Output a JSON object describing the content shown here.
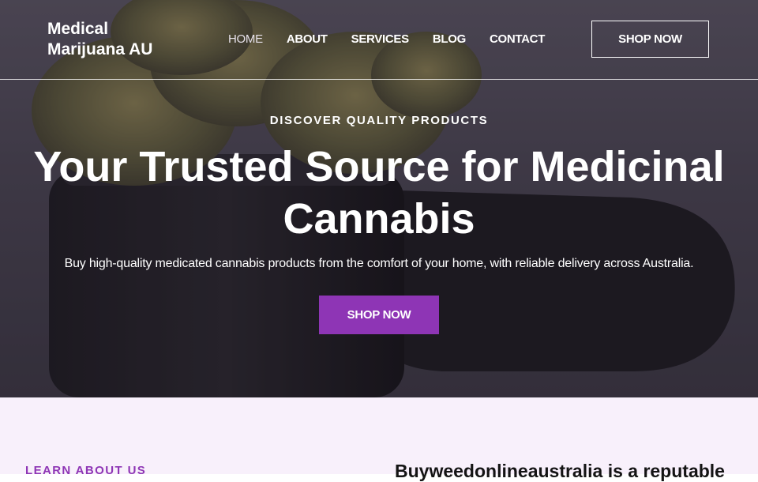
{
  "header": {
    "logo": "Medical Marijuana AU",
    "nav": [
      {
        "label": "HOME",
        "active": true
      },
      {
        "label": "ABOUT",
        "active": false
      },
      {
        "label": "SERVICES",
        "active": false
      },
      {
        "label": "BLOG",
        "active": false
      },
      {
        "label": "CONTACT",
        "active": false
      }
    ],
    "cta_label": "SHOP NOW"
  },
  "hero": {
    "eyebrow": "DISCOVER QUALITY PRODUCTS",
    "headline": "Your Trusted Source for Medicinal Cannabis",
    "subtext": "Buy high-quality medicated cannabis products from the comfort of your home, with reliable delivery across Australia.",
    "cta_label": "SHOP NOW"
  },
  "about": {
    "eyebrow": "LEARN ABOUT US",
    "heading": "Buyweedonlineaustralia is a reputable"
  },
  "colors": {
    "accent": "#8e35b5",
    "about_background": "#f8f0fb",
    "hero_overlay": "#3c3743"
  }
}
